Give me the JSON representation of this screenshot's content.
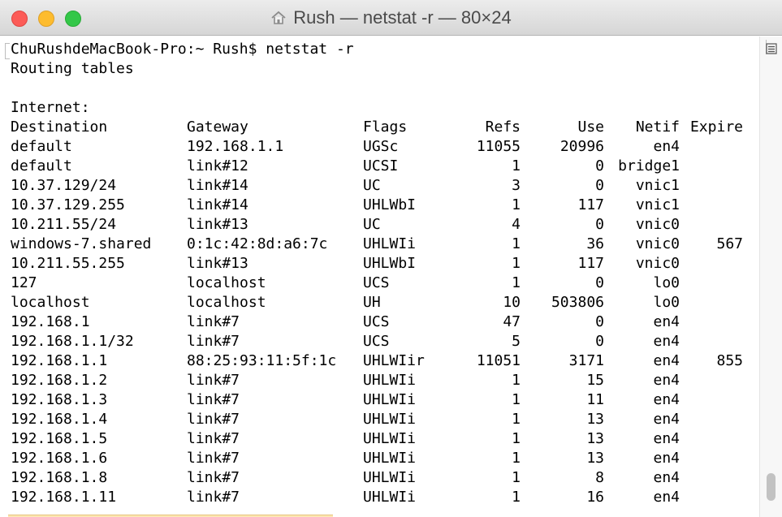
{
  "window": {
    "title": "Rush — netstat -r — 80×24"
  },
  "terminal": {
    "prompt_line": "ChuRushdeMacBook-Pro:~ Rush$ netstat -r",
    "routing_line": "Routing tables",
    "section_label": "Internet:",
    "headers": {
      "destination": "Destination",
      "gateway": "Gateway",
      "flags": "Flags",
      "refs": "Refs",
      "use": "Use",
      "netif": "Netif",
      "expire": "Expire"
    },
    "rows": [
      {
        "destination": "default",
        "gateway": "192.168.1.1",
        "flags": "UGSc",
        "refs": "11055",
        "use": "20996",
        "netif": "en4",
        "expire": ""
      },
      {
        "destination": "default",
        "gateway": "link#12",
        "flags": "UCSI",
        "refs": "1",
        "use": "0",
        "netif": "bridge1",
        "expire": ""
      },
      {
        "destination": "10.37.129/24",
        "gateway": "link#14",
        "flags": "UC",
        "refs": "3",
        "use": "0",
        "netif": "vnic1",
        "expire": ""
      },
      {
        "destination": "10.37.129.255",
        "gateway": "link#14",
        "flags": "UHLWbI",
        "refs": "1",
        "use": "117",
        "netif": "vnic1",
        "expire": ""
      },
      {
        "destination": "10.211.55/24",
        "gateway": "link#13",
        "flags": "UC",
        "refs": "4",
        "use": "0",
        "netif": "vnic0",
        "expire": ""
      },
      {
        "destination": "windows-7.shared",
        "gateway": "0:1c:42:8d:a6:7c",
        "flags": "UHLWIi",
        "refs": "1",
        "use": "36",
        "netif": "vnic0",
        "expire": "567"
      },
      {
        "destination": "10.211.55.255",
        "gateway": "link#13",
        "flags": "UHLWbI",
        "refs": "1",
        "use": "117",
        "netif": "vnic0",
        "expire": ""
      },
      {
        "destination": "127",
        "gateway": "localhost",
        "flags": "UCS",
        "refs": "1",
        "use": "0",
        "netif": "lo0",
        "expire": ""
      },
      {
        "destination": "localhost",
        "gateway": "localhost",
        "flags": "UH",
        "refs": "10",
        "use": "503806",
        "netif": "lo0",
        "expire": ""
      },
      {
        "destination": "192.168.1",
        "gateway": "link#7",
        "flags": "UCS",
        "refs": "47",
        "use": "0",
        "netif": "en4",
        "expire": ""
      },
      {
        "destination": "192.168.1.1/32",
        "gateway": "link#7",
        "flags": "UCS",
        "refs": "5",
        "use": "0",
        "netif": "en4",
        "expire": ""
      },
      {
        "destination": "192.168.1.1",
        "gateway": "88:25:93:11:5f:1c",
        "flags": "UHLWIir",
        "refs": "11051",
        "use": "3171",
        "netif": "en4",
        "expire": "855"
      },
      {
        "destination": "192.168.1.2",
        "gateway": "link#7",
        "flags": "UHLWIi",
        "refs": "1",
        "use": "15",
        "netif": "en4",
        "expire": ""
      },
      {
        "destination": "192.168.1.3",
        "gateway": "link#7",
        "flags": "UHLWIi",
        "refs": "1",
        "use": "11",
        "netif": "en4",
        "expire": ""
      },
      {
        "destination": "192.168.1.4",
        "gateway": "link#7",
        "flags": "UHLWIi",
        "refs": "1",
        "use": "13",
        "netif": "en4",
        "expire": ""
      },
      {
        "destination": "192.168.1.5",
        "gateway": "link#7",
        "flags": "UHLWIi",
        "refs": "1",
        "use": "13",
        "netif": "en4",
        "expire": ""
      },
      {
        "destination": "192.168.1.6",
        "gateway": "link#7",
        "flags": "UHLWIi",
        "refs": "1",
        "use": "13",
        "netif": "en4",
        "expire": ""
      },
      {
        "destination": "192.168.1.8",
        "gateway": "link#7",
        "flags": "UHLWIi",
        "refs": "1",
        "use": "8",
        "netif": "en4",
        "expire": ""
      },
      {
        "destination": "192.168.1.11",
        "gateway": "link#7",
        "flags": "UHLWIi",
        "refs": "1",
        "use": "16",
        "netif": "en4",
        "expire": ""
      }
    ]
  },
  "icons": {
    "home": "home-icon",
    "menu": "hamburger-icon"
  },
  "colors": {
    "close": "#fc5b57",
    "minimize": "#fdbc2e",
    "maximize": "#33c748",
    "text": "#000000"
  }
}
